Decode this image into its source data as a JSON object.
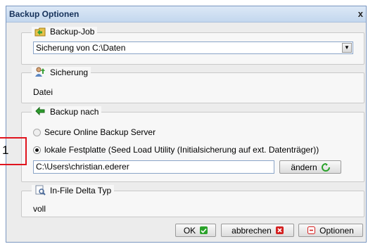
{
  "window": {
    "title": "Backup Optionen",
    "close_label": "x"
  },
  "backup_job": {
    "legend": "Backup-Job",
    "selected_value": "Sicherung von C:\\Daten"
  },
  "sicherung": {
    "legend": "Sicherung",
    "value": "Datei"
  },
  "backup_nach": {
    "legend": "Backup nach",
    "options": [
      {
        "label": "Secure Online Backup Server",
        "selected": false
      },
      {
        "label": "lokale Festplatte (Seed Load Utility (Initialsicherung auf ext. Datenträger))",
        "selected": true
      }
    ],
    "path_value": "C:\\Users\\christian.ederer",
    "change_button": "ändern"
  },
  "delta": {
    "legend": "In-File Delta Typ",
    "value": "voll"
  },
  "footer": {
    "ok": "OK",
    "cancel": "abbrechen",
    "options": "Optionen"
  },
  "annotation": {
    "marker_number": "1"
  },
  "colors": {
    "title_bar": "#c3d7ee",
    "marker": "#e0141e",
    "ok_icon": "#2aa22a",
    "cancel_icon": "#d42020"
  }
}
